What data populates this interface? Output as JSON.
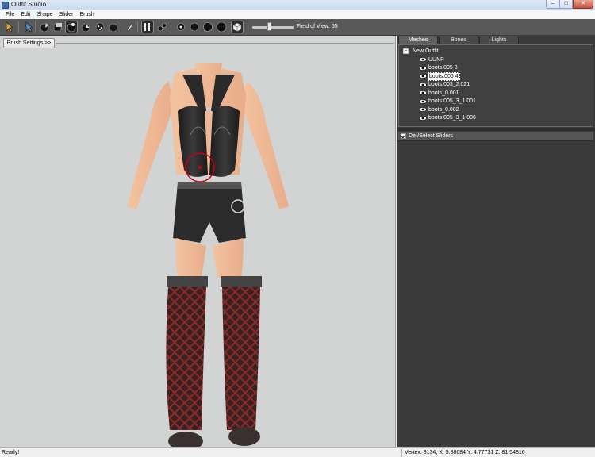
{
  "window": {
    "title": "Outfit Studio"
  },
  "menu": [
    "File",
    "Edit",
    "Shape",
    "Slider",
    "Brush"
  ],
  "toolbar": {
    "fov_label": "Field of View: 65",
    "fov_value": 65,
    "buttons": [
      "select-tool-icon",
      "brush-transform-icon",
      "standard-brush-icon",
      "deflate-brush-icon",
      "inflate-brush-icon",
      "move-brush-icon",
      "smooth-brush-icon",
      "weight-brush-icon",
      "color-brush-icon",
      "vertex-select-icon",
      "segment-icon",
      "brush-size-small-icon",
      "brush-size-medium-icon",
      "brush-size-large-icon",
      "brush-size-xlarge-icon",
      "view-cube-icon"
    ]
  },
  "viewport": {
    "brush_settings_label": "Brush Settings >>"
  },
  "panel": {
    "tabs": [
      "Meshes",
      "Bones",
      "Lights"
    ],
    "selected_tab": "Meshes",
    "root": "New Outfit",
    "meshes": [
      "UUNP",
      "boots.005 3",
      "boots.006 4",
      "boots.003_2.021",
      "boots_0.001",
      "boots.005_3_1.001",
      "boots_0.002",
      "boots.005_3_1.006"
    ],
    "selected_mesh": "boots.006 4",
    "sliders_header": "De-/Select Sliders"
  },
  "status": {
    "left": "Ready!",
    "right": "Vertex: 8134, X: 5.88684 Y: 4.77731 Z: 81.54816"
  },
  "colors": {
    "viewport_bg": "#d2d3d3",
    "panel_bg": "#3a3a3a",
    "toolbar_bg": "#595959"
  }
}
